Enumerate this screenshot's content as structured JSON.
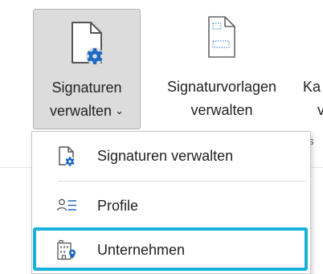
{
  "ribbon": {
    "buttons": [
      {
        "line1": "Signaturen",
        "line2": "verwalten",
        "chevron": "⌄",
        "icon": "signature-settings-icon",
        "pressed": true
      },
      {
        "line1": "Signaturvorlagen",
        "line2": "verwalten",
        "icon": "template-document-icon"
      },
      {
        "line1": "Ka",
        "line2": "v",
        "icon": ""
      }
    ],
    "clipped_fragment": "s"
  },
  "menu": {
    "items": [
      {
        "label": "Signaturen verwalten",
        "icon": "signature-settings-icon"
      },
      {
        "label": "Profile",
        "icon": "profile-list-icon"
      },
      {
        "label": "Unternehmen",
        "icon": "company-building-icon",
        "focused": true
      }
    ]
  },
  "colors": {
    "focus": "#1ab0d8",
    "icon_blue": "#1f6ac0",
    "pressed_bg": "#dcdcdc"
  }
}
